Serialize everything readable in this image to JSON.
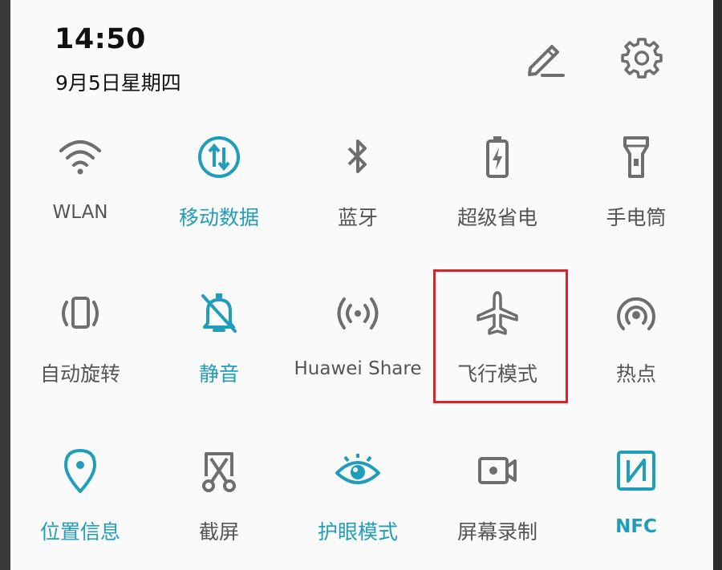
{
  "status": {
    "time": "14:50",
    "date": "9月5日星期四"
  },
  "header": {
    "edit_icon": "pencil-icon",
    "settings_icon": "gear-icon"
  },
  "colors": {
    "active": "#1f9dbb",
    "inactive": "#6e6e6e",
    "label": "#555555",
    "highlight": "#d6262b",
    "background": "#fafafa"
  },
  "tiles": [
    {
      "label": "WLAN",
      "icon": "wifi-icon",
      "active": false
    },
    {
      "label": "移动数据",
      "icon": "mobile-data-icon",
      "active": true
    },
    {
      "label": "蓝牙",
      "icon": "bluetooth-icon",
      "active": false
    },
    {
      "label": "超级省电",
      "icon": "battery-saver-icon",
      "active": false
    },
    {
      "label": "手电筒",
      "icon": "flashlight-icon",
      "active": false
    },
    {
      "label": "自动旋转",
      "icon": "auto-rotate-icon",
      "active": false
    },
    {
      "label": "静音",
      "icon": "mute-icon",
      "active": true
    },
    {
      "label": "Huawei Share",
      "icon": "huawei-share-icon",
      "active": false
    },
    {
      "label": "飞行模式",
      "icon": "airplane-icon",
      "active": false,
      "highlighted": true
    },
    {
      "label": "热点",
      "icon": "hotspot-icon",
      "active": false
    },
    {
      "label": "位置信息",
      "icon": "location-icon",
      "active": true
    },
    {
      "label": "截屏",
      "icon": "screenshot-icon",
      "active": false
    },
    {
      "label": "护眼模式",
      "icon": "eye-comfort-icon",
      "active": true
    },
    {
      "label": "屏幕录制",
      "icon": "screen-record-icon",
      "active": false
    },
    {
      "label": "NFC",
      "icon": "nfc-icon",
      "active": true
    }
  ]
}
